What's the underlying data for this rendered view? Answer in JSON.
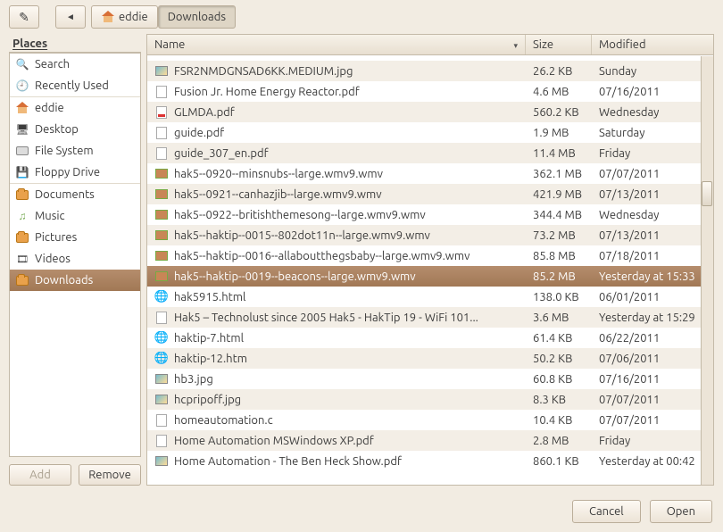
{
  "toolbar": {
    "path": [
      {
        "label": "eddie",
        "icon": "home",
        "active": false
      },
      {
        "label": "Downloads",
        "icon": null,
        "active": true
      }
    ]
  },
  "sidebar": {
    "header": "Places",
    "items": [
      {
        "label": "Search",
        "icon": "search",
        "selected": false
      },
      {
        "label": "Recently Used",
        "icon": "clock",
        "selected": false
      },
      {
        "label": "eddie",
        "icon": "home",
        "selected": false,
        "sep": true
      },
      {
        "label": "Desktop",
        "icon": "monitor",
        "selected": false
      },
      {
        "label": "File System",
        "icon": "drive",
        "selected": false
      },
      {
        "label": "Floppy Drive",
        "icon": "floppy",
        "selected": false
      },
      {
        "label": "Documents",
        "icon": "folder",
        "selected": false,
        "sep": true
      },
      {
        "label": "Music",
        "icon": "music",
        "selected": false
      },
      {
        "label": "Pictures",
        "icon": "folder",
        "selected": false
      },
      {
        "label": "Videos",
        "icon": "video",
        "selected": false
      },
      {
        "label": "Downloads",
        "icon": "folder",
        "selected": true
      }
    ],
    "add_label": "Add",
    "remove_label": "Remove"
  },
  "columns": {
    "name": "Name",
    "size": "Size",
    "modified": "Modified"
  },
  "files": [
    {
      "name": "FSR2NMDGNSAD6KK.MEDIUM.jpg",
      "icon": "img",
      "size": "26.2 KB",
      "mod": "Sunday"
    },
    {
      "name": "Fusion Jr. Home Energy Reactor.pdf",
      "icon": "file",
      "size": "4.6 MB",
      "mod": "07/16/2011"
    },
    {
      "name": "GLMDA.pdf",
      "icon": "pdf",
      "size": "560.2 KB",
      "mod": "Wednesday"
    },
    {
      "name": "guide.pdf",
      "icon": "file",
      "size": "1.9 MB",
      "mod": "Saturday"
    },
    {
      "name": "guide_307_en.pdf",
      "icon": "file",
      "size": "11.4 MB",
      "mod": "Friday"
    },
    {
      "name": "hak5--0920--minsnubs--large.wmv9.wmv",
      "icon": "vid",
      "size": "362.1 MB",
      "mod": "07/07/2011"
    },
    {
      "name": "hak5--0921--canhazjib--large.wmv9.wmv",
      "icon": "vid",
      "size": "421.9 MB",
      "mod": "07/13/2011"
    },
    {
      "name": "hak5--0922--britishthemesong--large.wmv9.wmv",
      "icon": "vid",
      "size": "344.4 MB",
      "mod": "Wednesday"
    },
    {
      "name": "hak5--haktip--0015--802dot11n--large.wmv9.wmv",
      "icon": "vid",
      "size": "73.2 MB",
      "mod": "07/13/2011"
    },
    {
      "name": "hak5--haktip--0016--allaboutthegsbaby--large.wmv9.wmv",
      "icon": "vid",
      "size": "85.8 MB",
      "mod": "07/18/2011"
    },
    {
      "name": "hak5--haktip--0019--beacons--large.wmv9.wmv",
      "icon": "vid",
      "size": "85.2 MB",
      "mod": "Yesterday at 15:33",
      "selected": true
    },
    {
      "name": "hak5915.html",
      "icon": "globe",
      "size": "138.0 KB",
      "mod": "06/01/2011"
    },
    {
      "name": "Hak5 – Technolust since 2005 Hak5 - HakTip 19 - WiFi 101...",
      "icon": "file",
      "size": "3.6 MB",
      "mod": "Yesterday at 15:29"
    },
    {
      "name": "haktip-7.html",
      "icon": "globe",
      "size": "61.4 KB",
      "mod": "06/22/2011"
    },
    {
      "name": "haktip-12.htm",
      "icon": "globe",
      "size": "50.2 KB",
      "mod": "07/06/2011"
    },
    {
      "name": "hb3.jpg",
      "icon": "img",
      "size": "60.8 KB",
      "mod": "07/16/2011"
    },
    {
      "name": "hcpripoff.jpg",
      "icon": "img",
      "size": "8.3 KB",
      "mod": "07/07/2011"
    },
    {
      "name": "homeautomation.c",
      "icon": "file",
      "size": "10.4 KB",
      "mod": "07/07/2011"
    },
    {
      "name": "Home Automation MSWindows XP.pdf",
      "icon": "file",
      "size": "2.8 MB",
      "mod": "Friday"
    },
    {
      "name": "Home Automation - The Ben Heck Show.pdf",
      "icon": "img",
      "size": "860.1 KB",
      "mod": "Yesterday at 00:42"
    }
  ],
  "buttons": {
    "cancel": "Cancel",
    "open": "Open"
  }
}
